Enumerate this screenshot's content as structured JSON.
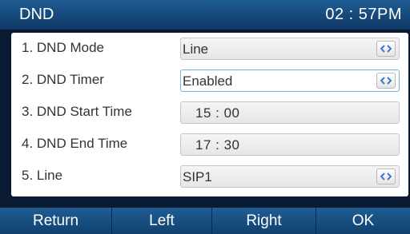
{
  "header": {
    "title": "DND",
    "time": "02 : 57PM"
  },
  "settings": [
    {
      "label": "1. DND Mode",
      "value": "Line",
      "has_selector": true,
      "selected": false
    },
    {
      "label": "2. DND Timer",
      "value": "Enabled",
      "has_selector": true,
      "selected": true
    },
    {
      "label": "3. DND Start Time",
      "value": "15 : 00",
      "has_selector": false,
      "selected": false
    },
    {
      "label": "4. DND End Time",
      "value": "17 : 30",
      "has_selector": false,
      "selected": false
    },
    {
      "label": "5. Line",
      "value": "SIP1",
      "has_selector": true,
      "selected": false
    }
  ],
  "softkeys": [
    "Return",
    "Left",
    "Right",
    "OK"
  ],
  "icons": {
    "selector": "left-right-arrows-icon"
  },
  "colors": {
    "header": "#1f5c93",
    "selected_border": "#6fb6d6",
    "arrow": "#3a78c9"
  }
}
